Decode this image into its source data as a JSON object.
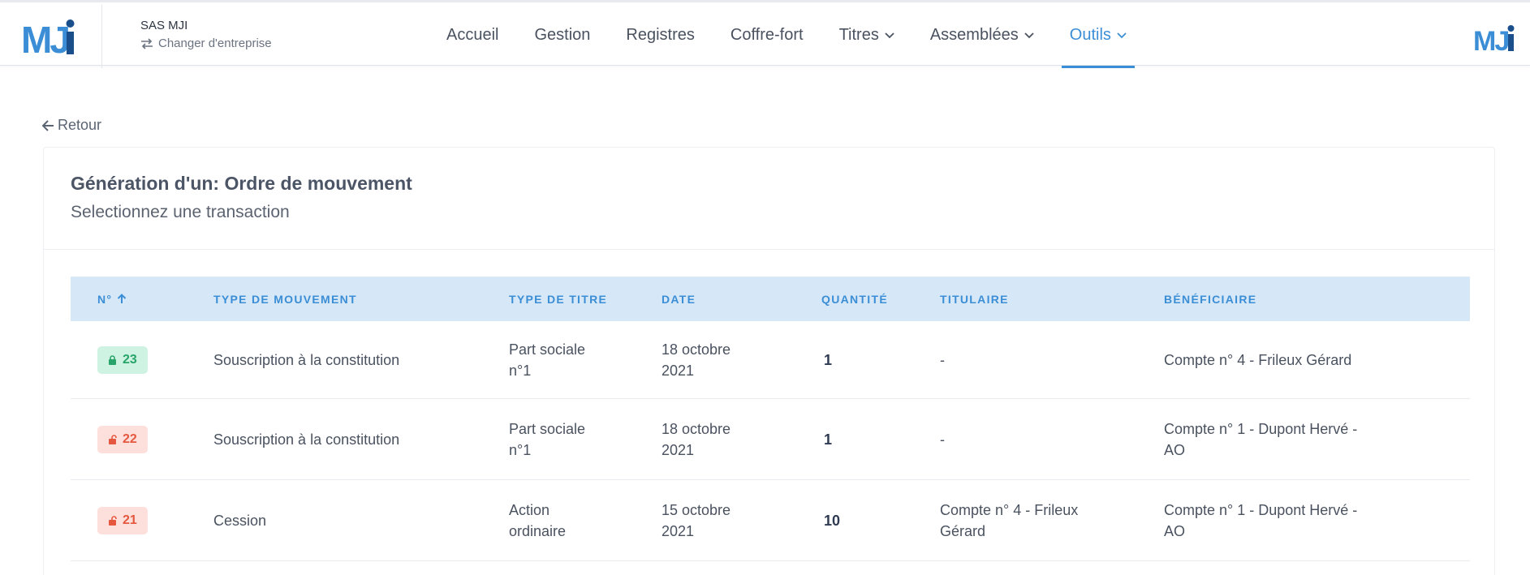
{
  "header": {
    "company_name": "SAS MJI",
    "change_company": "Changer d'entreprise",
    "logo_text": "MJI",
    "nav": [
      {
        "label": "Accueil",
        "dropdown": false,
        "active": false
      },
      {
        "label": "Gestion",
        "dropdown": false,
        "active": false
      },
      {
        "label": "Registres",
        "dropdown": false,
        "active": false
      },
      {
        "label": "Coffre-fort",
        "dropdown": false,
        "active": false
      },
      {
        "label": "Titres",
        "dropdown": true,
        "active": false
      },
      {
        "label": "Assemblées",
        "dropdown": true,
        "active": false
      },
      {
        "label": "Outils",
        "dropdown": true,
        "active": true
      }
    ]
  },
  "back_label": "Retour",
  "card": {
    "title": "Génération d'un: Ordre de mouvement",
    "subtitle": "Selectionnez une transaction"
  },
  "table": {
    "columns": [
      "N°",
      "TYPE DE MOUVEMENT",
      "TYPE DE TITRE",
      "DATE",
      "QUANTITÉ",
      "TITULAIRE",
      "BÉNÉFICIAIRE"
    ],
    "rows": [
      {
        "num": "23",
        "locked": true,
        "type": "Souscription à la constitution",
        "titre": [
          "Part sociale",
          "n°1"
        ],
        "date": [
          "18 octobre",
          "2021"
        ],
        "qty": "1",
        "titulaire": [
          "-"
        ],
        "beneficiaire": [
          "Compte n° 4 - Frileux Gérard"
        ]
      },
      {
        "num": "22",
        "locked": false,
        "type": "Souscription à la constitution",
        "titre": [
          "Part sociale",
          "n°1"
        ],
        "date": [
          "18 octobre",
          "2021"
        ],
        "qty": "1",
        "titulaire": [
          "-"
        ],
        "beneficiaire": [
          "Compte n° 1 - Dupont Hervé -",
          "AO"
        ]
      },
      {
        "num": "21",
        "locked": false,
        "type": "Cession",
        "titre": [
          "Action",
          "ordinaire"
        ],
        "date": [
          "15 octobre",
          "2021"
        ],
        "qty": "10",
        "titulaire": [
          "Compte n° 4 - Frileux",
          "Gérard"
        ],
        "beneficiaire": [
          "Compte n° 1 - Dupont Hervé -",
          "AO"
        ]
      }
    ]
  },
  "colors": {
    "accent": "#3b8ed6",
    "header_bg": "#d6e8f7",
    "locked": "#27a46a",
    "unlocked": "#e5573e"
  }
}
